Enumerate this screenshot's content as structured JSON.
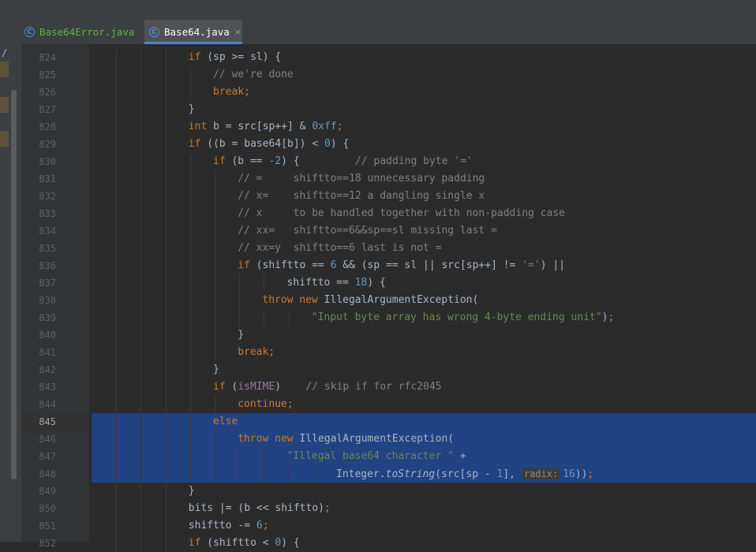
{
  "tabs": [
    {
      "label": "Base64Error.java",
      "icon": "class-icon",
      "active": false
    },
    {
      "label": "Base64.java",
      "icon": "class-icon",
      "active": true,
      "close": "×"
    }
  ],
  "left_strip_glyph": "/",
  "current_line": 845,
  "selection_lines": [
    845,
    846,
    847,
    848
  ],
  "colors": {
    "keyword": "#cc7832",
    "number": "#6897bb",
    "comment": "#808080",
    "string": "#6a8759",
    "field": "#9876aa",
    "selection": "#214283"
  },
  "lines": [
    {
      "n": 824,
      "indent": 4,
      "tokens": [
        [
          "kw",
          "if"
        ],
        [
          "t",
          " (sp >= sl) {"
        ]
      ]
    },
    {
      "n": 825,
      "indent": 5,
      "tokens": [
        [
          "cm",
          "// we're done"
        ]
      ]
    },
    {
      "n": 826,
      "indent": 5,
      "tokens": [
        [
          "kw",
          "break"
        ],
        [
          "kw",
          ";"
        ]
      ]
    },
    {
      "n": 827,
      "indent": 4,
      "tokens": [
        [
          "t",
          "}"
        ]
      ]
    },
    {
      "n": 828,
      "indent": 4,
      "tokens": [
        [
          "kw",
          "int"
        ],
        [
          "t",
          " b = src[sp++] & "
        ],
        [
          "num",
          "0xff"
        ],
        [
          "kw",
          ";"
        ]
      ]
    },
    {
      "n": 829,
      "indent": 4,
      "tokens": [
        [
          "kw",
          "if"
        ],
        [
          "t",
          " ((b = base64[b]) < "
        ],
        [
          "num",
          "0"
        ],
        [
          "t",
          ") {"
        ]
      ]
    },
    {
      "n": 830,
      "indent": 5,
      "tokens": [
        [
          "kw",
          "if"
        ],
        [
          "t",
          " (b == "
        ],
        [
          "num",
          "-2"
        ],
        [
          "t",
          ") {         "
        ],
        [
          "cm",
          "// padding byte '='"
        ]
      ]
    },
    {
      "n": 831,
      "indent": 6,
      "tokens": [
        [
          "cm",
          "// =     shiftto==18 unnecessary padding"
        ]
      ]
    },
    {
      "n": 832,
      "indent": 6,
      "tokens": [
        [
          "cm",
          "// x=    shiftto==12 a dangling single x"
        ]
      ]
    },
    {
      "n": 833,
      "indent": 6,
      "tokens": [
        [
          "cm",
          "// x     to be handled together with non-padding case"
        ]
      ]
    },
    {
      "n": 834,
      "indent": 6,
      "tokens": [
        [
          "cm",
          "// xx=   shiftto==6&&sp==sl missing last ="
        ]
      ]
    },
    {
      "n": 835,
      "indent": 6,
      "tokens": [
        [
          "cm",
          "// xx=y  shiftto==6 last is not ="
        ]
      ]
    },
    {
      "n": 836,
      "indent": 6,
      "tokens": [
        [
          "kw",
          "if"
        ],
        [
          "t",
          " (shiftto == "
        ],
        [
          "num",
          "6"
        ],
        [
          "t",
          " && (sp == sl || src[sp++] != "
        ],
        [
          "str",
          "'='"
        ],
        [
          "t",
          ") ||"
        ]
      ]
    },
    {
      "n": 837,
      "indent": 8,
      "tokens": [
        [
          "t",
          "shiftto == "
        ],
        [
          "num",
          "18"
        ],
        [
          "t",
          ") {"
        ]
      ]
    },
    {
      "n": 838,
      "indent": 7,
      "tokens": [
        [
          "kw",
          "throw new"
        ],
        [
          "t",
          " IllegalArgumentException("
        ]
      ]
    },
    {
      "n": 839,
      "indent": 9,
      "tokens": [
        [
          "str",
          "\"Input byte array has wrong 4-byte ending unit\""
        ],
        [
          "t",
          ")"
        ],
        [
          "kw",
          ";"
        ]
      ]
    },
    {
      "n": 840,
      "indent": 6,
      "tokens": [
        [
          "t",
          "}"
        ]
      ]
    },
    {
      "n": 841,
      "indent": 6,
      "tokens": [
        [
          "kw",
          "break"
        ],
        [
          "kw",
          ";"
        ]
      ]
    },
    {
      "n": 842,
      "indent": 5,
      "tokens": [
        [
          "t",
          "}"
        ]
      ]
    },
    {
      "n": 843,
      "indent": 5,
      "tokens": [
        [
          "kw",
          "if"
        ],
        [
          "t",
          " ("
        ],
        [
          "fld",
          "isMIME"
        ],
        [
          "t",
          ")    "
        ],
        [
          "cm",
          "// skip if for rfc2045"
        ]
      ]
    },
    {
      "n": 844,
      "indent": 6,
      "tokens": [
        [
          "kw",
          "continue"
        ],
        [
          "kw",
          ";"
        ]
      ]
    },
    {
      "n": 845,
      "indent": 5,
      "tokens": [
        [
          "kw",
          "else"
        ]
      ]
    },
    {
      "n": 846,
      "indent": 6,
      "tokens": [
        [
          "kw",
          "throw new"
        ],
        [
          "t",
          " IllegalArgumentException("
        ]
      ]
    },
    {
      "n": 847,
      "indent": 8,
      "tokens": [
        [
          "str",
          "\"Illegal base64 character \""
        ],
        [
          "t",
          " +"
        ]
      ]
    },
    {
      "n": 848,
      "indent": 10,
      "tokens": [
        [
          "t",
          "Integer."
        ],
        [
          "it",
          "toString"
        ],
        [
          "t",
          "(src[sp - "
        ],
        [
          "num",
          "1"
        ],
        [
          "t",
          "], "
        ],
        [
          "hint",
          "radix:"
        ],
        [
          "num",
          "16"
        ],
        [
          "t",
          "))"
        ],
        [
          "kw",
          ";"
        ]
      ]
    },
    {
      "n": 849,
      "indent": 4,
      "tokens": [
        [
          "t",
          "}"
        ]
      ]
    },
    {
      "n": 850,
      "indent": 4,
      "tokens": [
        [
          "t",
          "bits |= (b << shiftto)"
        ],
        [
          "kw",
          ";"
        ]
      ]
    },
    {
      "n": 851,
      "indent": 4,
      "tokens": [
        [
          "t",
          "shiftto -= "
        ],
        [
          "num",
          "6"
        ],
        [
          "kw",
          ";"
        ]
      ]
    },
    {
      "n": 852,
      "indent": 4,
      "tokens": [
        [
          "kw",
          "if"
        ],
        [
          "t",
          " (shiftto < "
        ],
        [
          "num",
          "0"
        ],
        [
          "t",
          ") {"
        ]
      ]
    }
  ]
}
